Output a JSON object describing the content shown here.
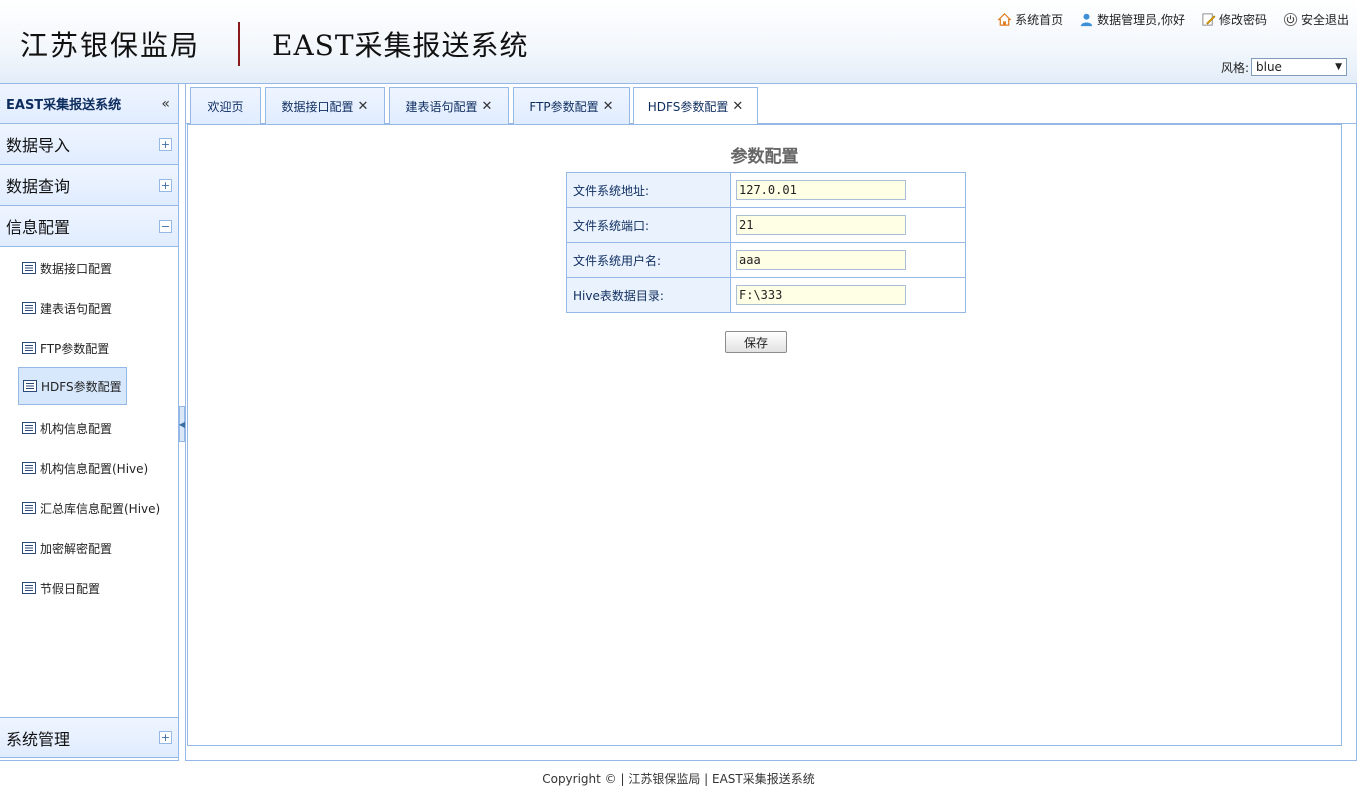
{
  "header": {
    "org_name": "江苏银保监局",
    "system_name": "EAST采集报送系统",
    "links": {
      "home": "系统首页",
      "user": "数据管理员,你好",
      "change_password": "修改密码",
      "logout": "安全退出"
    },
    "style_label": "风格:",
    "style_value": "blue"
  },
  "sidebar": {
    "title": "EAST采集报送系统",
    "collapse_glyph": "«",
    "sections": {
      "import": "数据导入",
      "query": "数据查询",
      "config": "信息配置",
      "system": "系统管理"
    },
    "items": [
      "数据接口配置",
      "建表语句配置",
      "FTP参数配置",
      "HDFS参数配置",
      "机构信息配置",
      "机构信息配置(Hive)",
      "汇总库信息配置(Hive)",
      "加密解密配置",
      "节假日配置"
    ]
  },
  "tabs": [
    {
      "label": "欢迎页",
      "closable": false
    },
    {
      "label": "数据接口配置",
      "closable": true
    },
    {
      "label": "建表语句配置",
      "closable": true
    },
    {
      "label": "FTP参数配置",
      "closable": true
    },
    {
      "label": "HDFS参数配置",
      "closable": true,
      "active": true
    }
  ],
  "form": {
    "title": "参数配置",
    "fields": [
      {
        "label": "文件系统地址:",
        "value": "127.0.01"
      },
      {
        "label": "文件系统端口:",
        "value": "21"
      },
      {
        "label": "文件系统用户名:",
        "value": "aaa"
      },
      {
        "label": "Hive表数据目录:",
        "value": "F:\\333"
      }
    ],
    "save_label": "保存"
  },
  "footer": {
    "text": "Copyright © | 江苏银保监局 | EAST采集报送系统"
  },
  "colors": {
    "border": "#95b8e7",
    "panel_header": "#e0ecff",
    "input_bg": "#ffffe6",
    "logo_divider": "#8b1a1a"
  }
}
